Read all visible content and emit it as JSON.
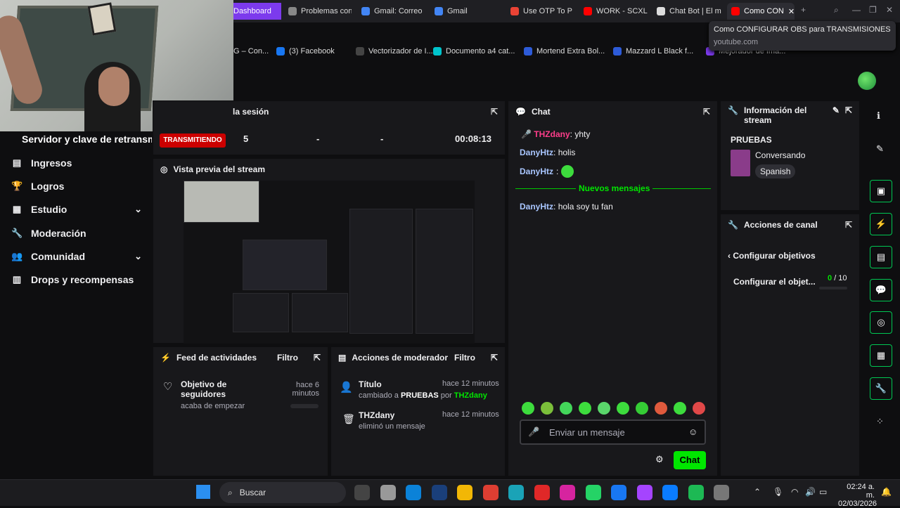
{
  "browser": {
    "tabs": [
      {
        "label": "Dashboard",
        "icon": "twitch-icon",
        "color": "#7c3aed"
      },
      {
        "label": "Problemas con",
        "icon": "chatgpt-icon",
        "color": "#888"
      },
      {
        "label": "Gmail: Correo",
        "icon": "google-icon",
        "color": "#4285f4"
      },
      {
        "label": "Gmail",
        "icon": "google-icon",
        "color": "#4285f4"
      },
      {
        "label": "Use OTP To P",
        "icon": "gmail-icon",
        "color": "#ea4335"
      },
      {
        "label": "WORK - SCXL",
        "icon": "youtube-icon",
        "color": "#ff0000"
      },
      {
        "label": "Chat Bot | El m",
        "icon": "bot-icon",
        "color": "#dddddd"
      },
      {
        "label": "Como CON",
        "icon": "youtube-icon",
        "color": "#ff0000"
      }
    ],
    "tooltip": {
      "title": "Como CONFIGURAR OBS para TRANSMISIONES en...",
      "url": "youtube.com"
    },
    "bookmarks": [
      {
        "label": "G – Con...",
        "color": "#888"
      },
      {
        "label": "(3) Facebook",
        "color": "#1877f2"
      },
      {
        "label": "Vectorizador de I...",
        "color": "#444"
      },
      {
        "label": "Documento a4 cat...",
        "color": "#00c4cc"
      },
      {
        "label": "Mortend Extra Bol...",
        "color": "#2d5bd8"
      },
      {
        "label": "Mazzard L Black f...",
        "color": "#2d5bd8"
      },
      {
        "label": "Mejorador de Ima...",
        "color": "#7c3aed"
      }
    ]
  },
  "nav": {
    "title": "Servidor y clave de retransm",
    "items": [
      {
        "label": "Ingresos",
        "icon": "ingresos-icon",
        "glyph": "▤"
      },
      {
        "label": "Logros",
        "icon": "trophy-icon",
        "glyph": "🏆"
      },
      {
        "label": "Estudio",
        "icon": "studio-icon",
        "glyph": "▦",
        "chevron": "⌄"
      },
      {
        "label": "Moderación",
        "icon": "wrench-icon",
        "glyph": "🔧"
      },
      {
        "label": "Comunidad",
        "icon": "community-icon",
        "glyph": "👥",
        "chevron": "⌄"
      },
      {
        "label": "Drops y recompensas",
        "icon": "drops-icon",
        "glyph": "▥"
      }
    ]
  },
  "session": {
    "title": "la sesión",
    "live_label": "TRANSMITIENDO",
    "viewers": "5",
    "stat2": "-",
    "stat3": "-",
    "time": "00:08:13"
  },
  "preview": {
    "title": "Vista previa del stream"
  },
  "feed": {
    "title": "Feed de actividades",
    "filter": "Filtro",
    "item_title": "Objetivo de seguidores",
    "item_sub": "acaba de empezar",
    "item_time": "hace 6 minutos"
  },
  "modactions": {
    "title": "Acciones de moderador",
    "filter": "Filtro",
    "items": [
      {
        "title": "Título",
        "sub_prefix": "cambiado a",
        "sub_value": "PRUEBAS",
        "sub_by": "por",
        "sub_user": "THZdany",
        "time": "hace 12 minutos"
      },
      {
        "title": "THZdany",
        "sub": "eliminó un mensaje",
        "time": "hace 12 minutos"
      }
    ]
  },
  "chat": {
    "title": "Chat",
    "messages": [
      {
        "user": "THZdany",
        "text": "yhty",
        "color": "#ff3d8b"
      },
      {
        "user": "DanyHtz",
        "text": "holis",
        "color": "#a9c6ff"
      },
      {
        "user": "DanyHtz",
        "text": "",
        "color": "#a9c6ff"
      }
    ],
    "new_messages": "Nuevos mensajes",
    "after": {
      "user": "DanyHtz",
      "text": "hola soy tu fan"
    },
    "placeholder": "Enviar un mensaje",
    "send": "Chat"
  },
  "info": {
    "title": "Información del stream",
    "stream_title": "PRUEBAS",
    "category": "Conversando",
    "tag": "Spanish"
  },
  "canal": {
    "title": "Acciones de canal",
    "back": "Configurar objetivos",
    "goal_label": "Configurar el objet...",
    "goal_progress": "0",
    "goal_total": "/ 10"
  },
  "taskbar": {
    "search": "Buscar",
    "time": "02:24 a. m.",
    "date": "02/03/2026"
  }
}
